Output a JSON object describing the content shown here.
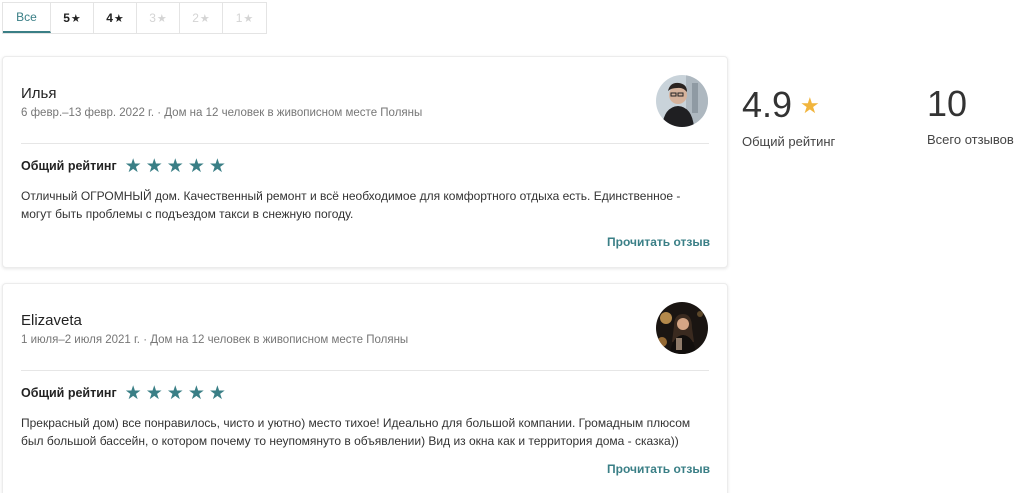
{
  "filters": [
    {
      "label": "Все",
      "star": ""
    },
    {
      "label": "5",
      "star": "★"
    },
    {
      "label": "4",
      "star": "★"
    },
    {
      "label": "3",
      "star": "★"
    },
    {
      "label": "2",
      "star": "★"
    },
    {
      "label": "1",
      "star": "★"
    }
  ],
  "reviews": [
    {
      "name": "Илья",
      "meta": "6 февр.–13 февр. 2022 г. · Дом на 12 человек в живописном месте Поляны",
      "rating_label": "Общий рейтинг",
      "stars": "★",
      "text": "Отличный ОГРОМНЫЙ дом. Качественный ремонт и всё необходимое для комфортного отдыха есть. Единственное - могут быть проблемы с подъездом такси в снежную погоду.",
      "read_more": "Прочитать отзыв"
    },
    {
      "name": "Elizaveta",
      "meta": "1 июля–2 июля 2021 г. · Дом на 12 человек в живописном месте Поляны",
      "rating_label": "Общий рейтинг",
      "stars": "★",
      "text": "Прекрасный дом) все понравилось, чисто и уютно) место тихое! Идеально для большой компании. Громадным плюсом был большой бассейн, о котором почему то неупомянуто в объявлении) Вид из окна как и территория дома - сказка))",
      "read_more": "Прочитать отзыв"
    }
  ],
  "summary": {
    "rating_value": "4.9",
    "rating_star": "★",
    "rating_label": "Общий рейтинг",
    "total_value": "10",
    "total_label": "Всего отзывов"
  },
  "colors": {
    "accent": "#3a7f86",
    "summary_star": "#f1b53d"
  }
}
